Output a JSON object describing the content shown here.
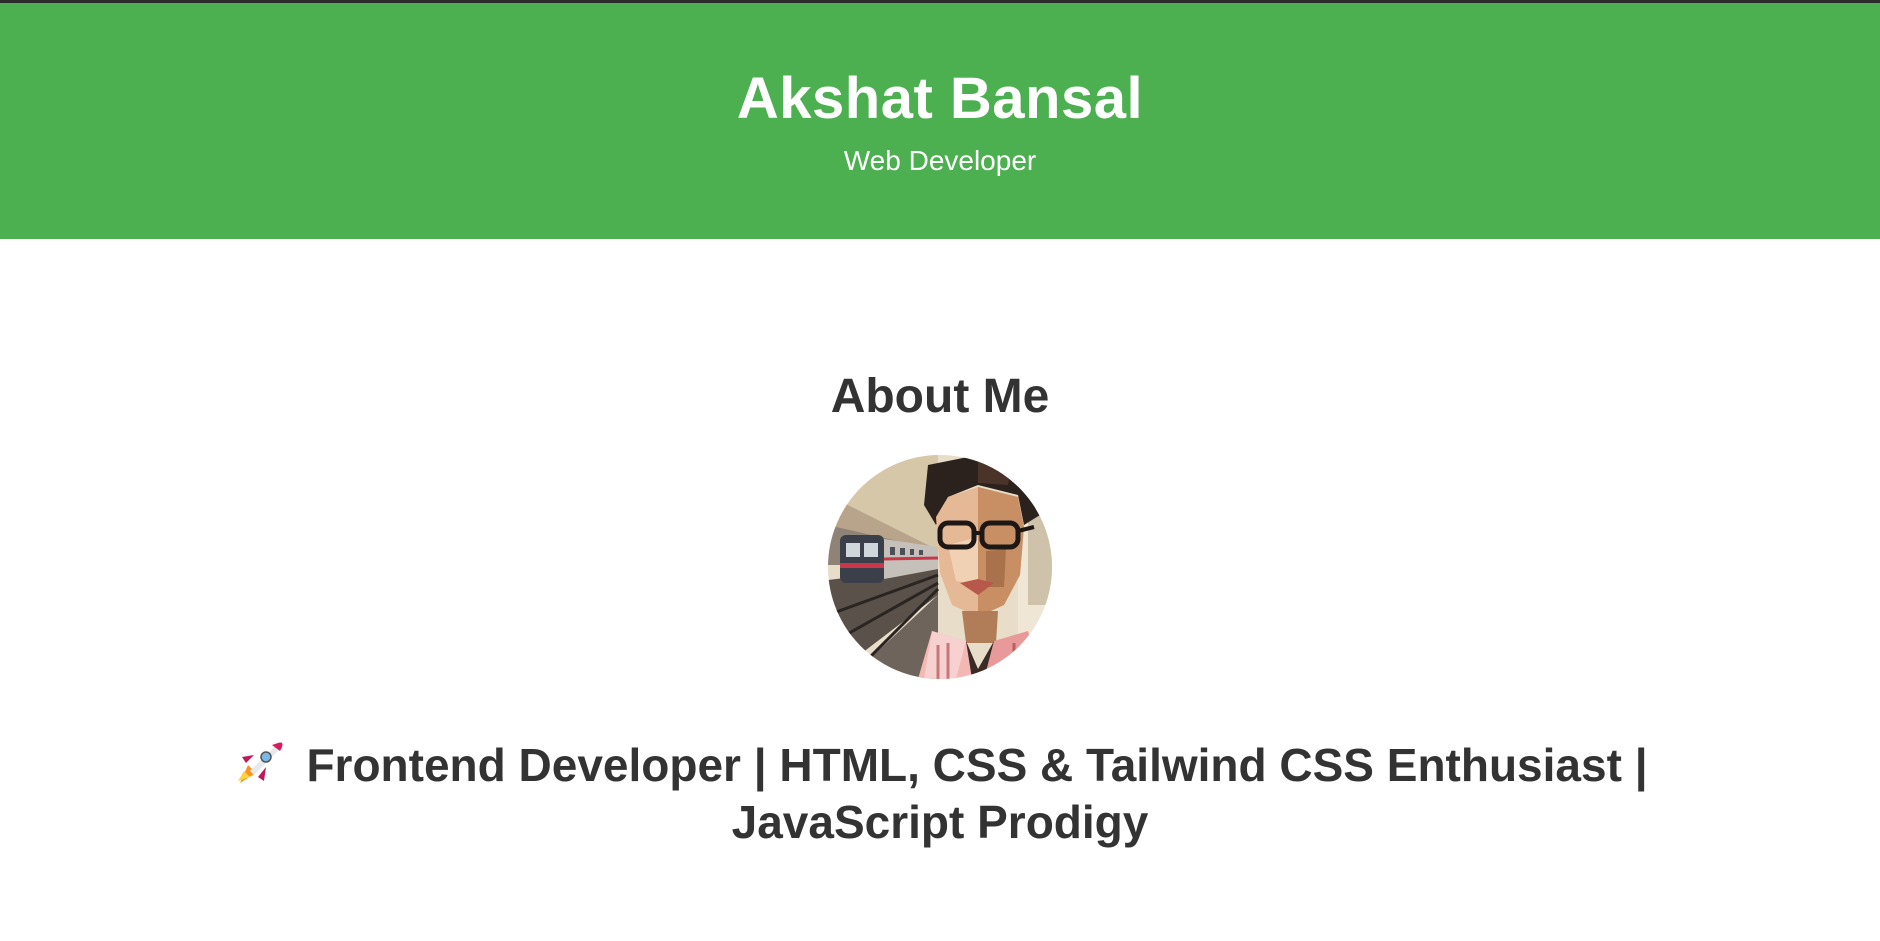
{
  "header": {
    "name": "Akshat Bansal",
    "role": "Web Developer"
  },
  "about": {
    "heading": "About Me",
    "avatar_icon": "profile-illustration",
    "tagline_icon": "rocket-icon",
    "tagline": "Frontend Developer | HTML, CSS & Tailwind CSS Enthusiast | JavaScript Prodigy"
  },
  "colors": {
    "header_bg": "#4caf50",
    "text": "#333333",
    "header_text": "#ffffff"
  }
}
